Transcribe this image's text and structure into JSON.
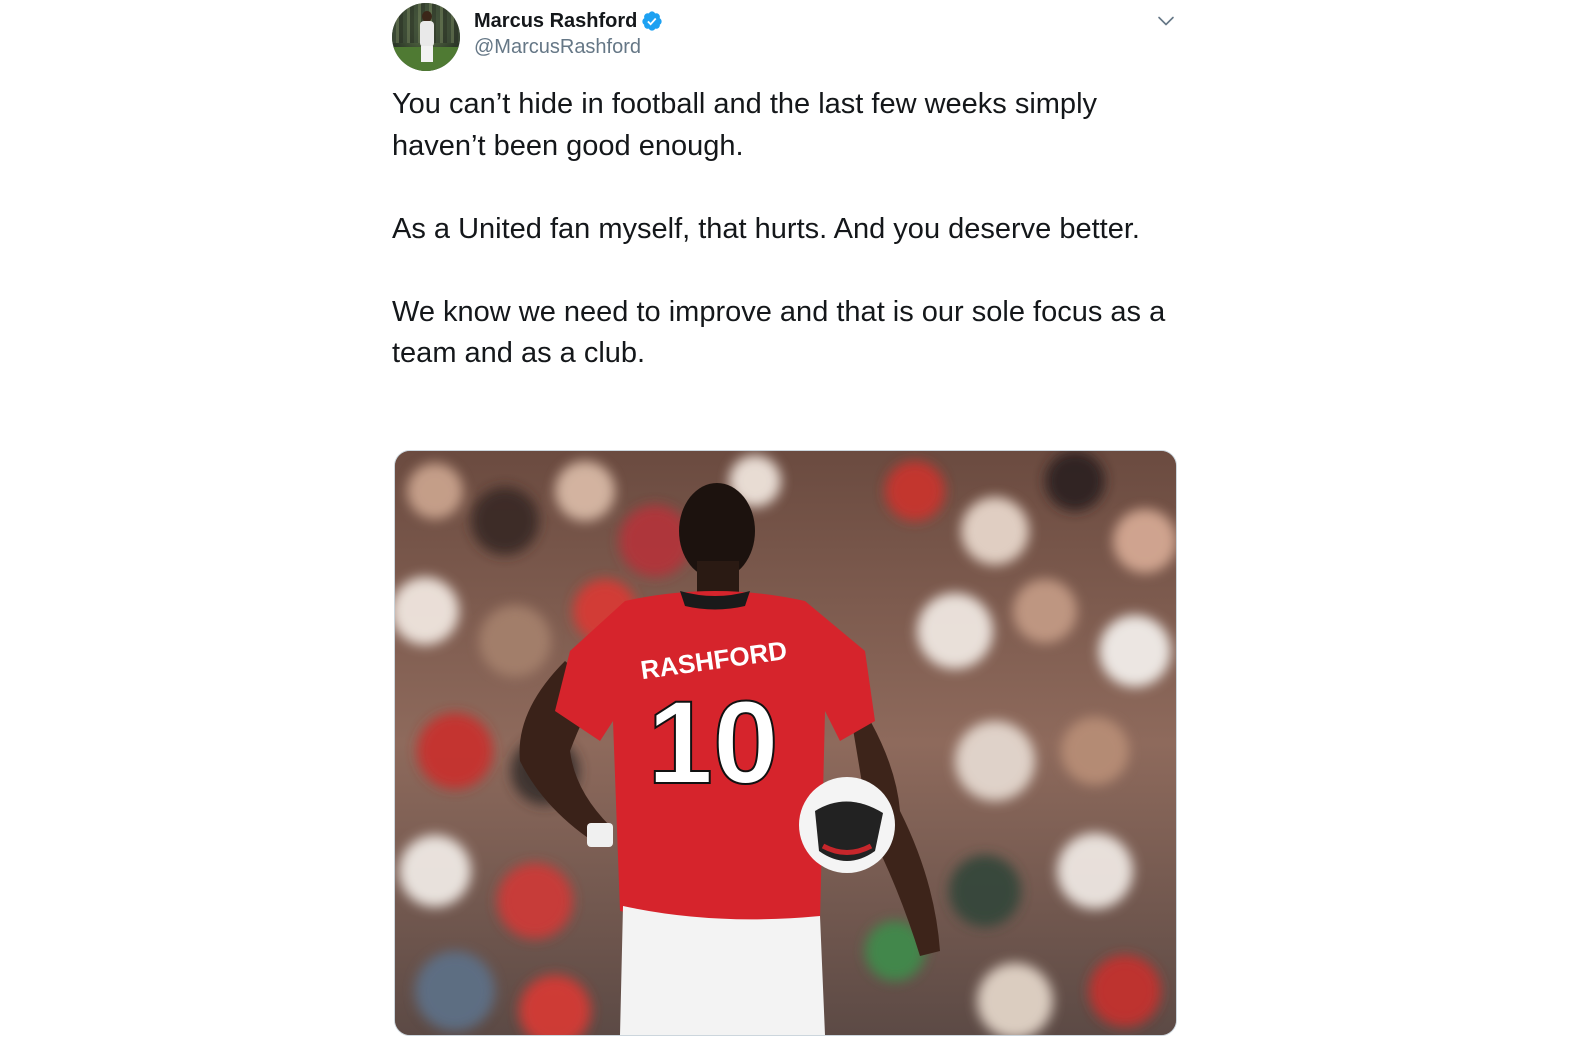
{
  "author": {
    "display_name": "Marcus Rashford",
    "handle": "@MarcusRashford",
    "verified": true,
    "verified_color": "#1da1f2"
  },
  "tweet": {
    "paragraphs": [
      "You can’t hide in football and the last few weeks simply haven’t been good enough.",
      "As a United fan myself, that hurts. And you deserve better.",
      "We know we need to improve and that is our sole focus as a team and as a club."
    ]
  },
  "media": {
    "shirt_name": "RASHFORD",
    "shirt_number": "10",
    "shirt_color": "#d6242c"
  },
  "icons": {
    "verified": "verified-badge-icon",
    "menu": "chevron-down-icon"
  }
}
